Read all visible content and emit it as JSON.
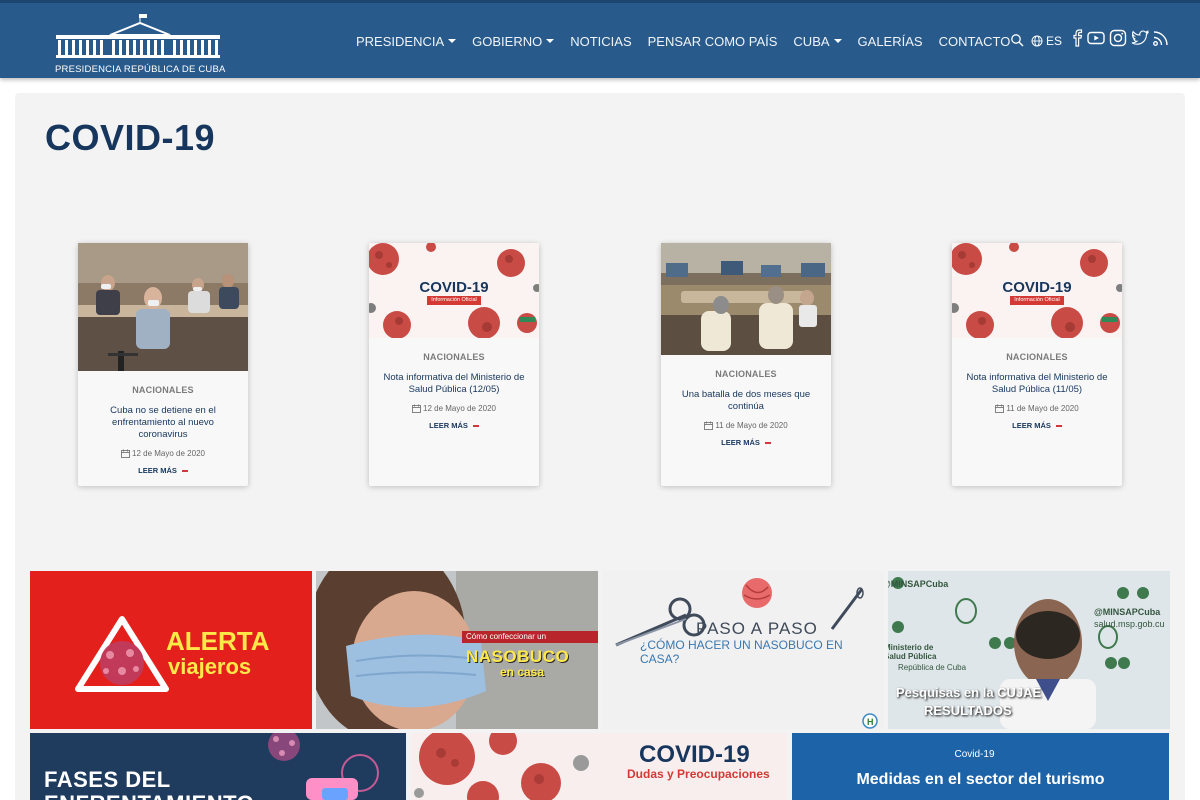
{
  "brand": {
    "name": "PRESIDENCIA REPÚBLICA DE CUBA"
  },
  "nav": {
    "items": [
      {
        "label": "PRESIDENCIA",
        "dropdown": true
      },
      {
        "label": "GOBIERNO",
        "dropdown": true
      },
      {
        "label": "NOTICIAS",
        "dropdown": false
      },
      {
        "label": "PENSAR COMO PAÍS",
        "dropdown": false
      },
      {
        "label": "CUBA",
        "dropdown": true
      },
      {
        "label": "GALERÍAS",
        "dropdown": false
      },
      {
        "label": "CONTACTO",
        "dropdown": false
      }
    ],
    "search_icon": "search-icon",
    "language": "ES",
    "social": [
      "facebook-icon",
      "youtube-icon",
      "instagram-icon",
      "twitter-icon",
      "rss-icon"
    ]
  },
  "page": {
    "title": "COVID-19"
  },
  "cards": [
    {
      "category": "NACIONALES",
      "title": "Cuba no se detiene en el enfrentamiento al nuevo coronavirus",
      "date": "12 de Mayo de 2020",
      "more": "LEER MÁS"
    },
    {
      "category": "NACIONALES",
      "title": "Nota informativa del Ministerio de Salud Pública (12/05)",
      "date": "12 de Mayo de 2020",
      "more": "LEER MÁS"
    },
    {
      "category": "NACIONALES",
      "title": "Una batalla de dos meses que continúa",
      "date": "11 de Mayo de 2020",
      "more": "LEER MÁS"
    },
    {
      "category": "NACIONALES",
      "title": "Nota informativa del Ministerio de Salud Pública (11/05)",
      "date": "11 de Mayo de 2020",
      "more": "LEER MÁS"
    }
  ],
  "covid_banner": {
    "title": "COVID-19",
    "subtitle": "Información Oficial"
  },
  "tiles": {
    "alerta": {
      "line1": "ALERTA",
      "line2": "viajeros"
    },
    "nasobuco": {
      "line1": "Cómo confeccionar un",
      "line2": "NASOBUCO",
      "line3": "en casa"
    },
    "paso": {
      "line1": "PASO A PASO",
      "line2": "¿CÓMO HACER UN NASOBUCO EN CASA?"
    },
    "pesquisas": {
      "line1": "Pesquisas en la CUJAE",
      "line2": "RESULTADOS",
      "watermark1": "@MINSAPCuba",
      "watermark2": "salud.msp.gob.cu",
      "watermark3": "Ministerio de Salud Pública",
      "watermark4": "República de Cuba"
    },
    "fases": {
      "line1": "FASES DEL",
      "line2": "ENFRENTAMIENTO"
    },
    "dudas": {
      "line1": "COVID-19",
      "line2": "Dudas y Preocupaciones"
    },
    "turismo": {
      "line1": "Covid-19",
      "line2": "Medidas en el sector del turismo"
    }
  },
  "colors": {
    "header_bg": "#285a8c",
    "title_color": "#17365d",
    "accent_red": "#d0363b"
  }
}
